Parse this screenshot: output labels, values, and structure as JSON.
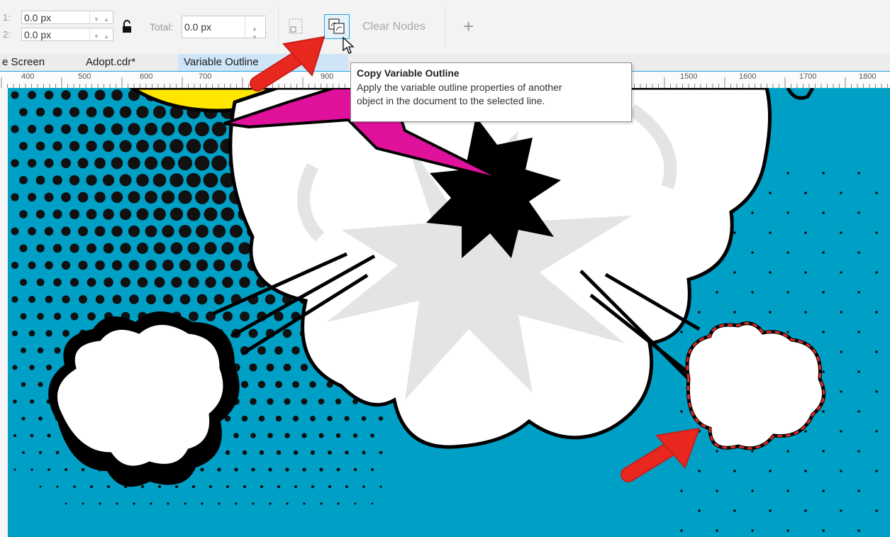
{
  "toolbar": {
    "field1_label": "1:",
    "field1_value": "0.0 px",
    "field2_label": "2:",
    "field2_value": "0.0 px",
    "total_label": "Total:",
    "total_value": "0.0 px",
    "clear_nodes_label": "Clear Nodes",
    "add_label": "+"
  },
  "tabs": [
    {
      "label": "e Screen"
    },
    {
      "label": "Adopt.cdr*"
    },
    {
      "label": "Variable Outline"
    }
  ],
  "ruler": {
    "labels": [
      "400",
      "500",
      "600",
      "700",
      "900",
      "1500",
      "1600",
      "1700",
      "1800"
    ]
  },
  "tooltip": {
    "title": "Copy Variable Outline",
    "body_line1": "Apply the variable outline properties of another",
    "body_line2": "object in the document to the selected line."
  },
  "colors": {
    "canvas_blue": "#00a0c6",
    "accent_red": "#e8281f",
    "magenta": "#e0119b",
    "yellow": "#ffe600",
    "tab_active": "#cfe5f7",
    "ruler_highlight": "#1fa3e0"
  },
  "icons": {
    "lock": "lock-open-icon",
    "copy_outline": "copy-variable-outline-icon",
    "add": "plus-icon",
    "cursor": "mouse-pointer-icon"
  }
}
